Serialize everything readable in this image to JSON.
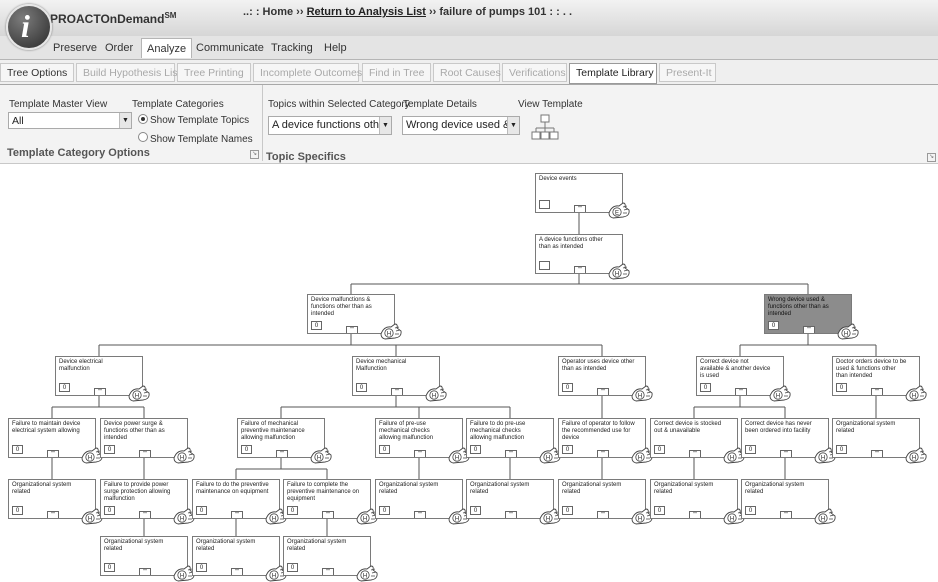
{
  "app": {
    "logo_letter": "i",
    "name": "PROACTOnDemand",
    "trademark": "SM"
  },
  "breadcrumb": {
    "prefix": "..: : Home ›› ",
    "link": "Return to Analysis List",
    "suffix": " ›› failure of pumps 101 : : . ."
  },
  "main_nav": [
    "Preserve",
    "Order",
    "Analyze",
    "Communicate",
    "Tracking",
    "Help"
  ],
  "main_nav_active": "Analyze",
  "sub_tabs": [
    {
      "label": "Tree Options",
      "state": "enabled"
    },
    {
      "label": "Build Hypothesis List",
      "state": "disabled"
    },
    {
      "label": "Tree Printing",
      "state": "disabled"
    },
    {
      "label": "Incomplete Outcomes",
      "state": "disabled"
    },
    {
      "label": "Find in Tree",
      "state": "disabled"
    },
    {
      "label": "Root Causes",
      "state": "disabled"
    },
    {
      "label": "Verifications",
      "state": "disabled"
    },
    {
      "label": "Template Library",
      "state": "active"
    },
    {
      "label": "Present-It",
      "state": "disabled"
    }
  ],
  "ribbon": {
    "master_view": {
      "label": "Template Master View",
      "value": "All"
    },
    "categories": {
      "label": "Template Categories",
      "options": [
        {
          "label": "Show Template Topics",
          "checked": true
        },
        {
          "label": "Show Template Names",
          "checked": false
        }
      ]
    },
    "left_group_title": "Template Category Options",
    "topics": {
      "label": "Topics within Selected Category",
      "value": "A device functions other th"
    },
    "details": {
      "label": "Template Details",
      "value": "Wrong device used & fun"
    },
    "view": {
      "label": "View Template"
    },
    "right_group_title": "Topic Specifics"
  },
  "tree": {
    "expand_glyph": "\"\"",
    "nodes": [
      {
        "id": "n1",
        "text": "Device events",
        "count": "",
        "badge": "E",
        "highlight": false
      },
      {
        "id": "n2",
        "text": "A device functions other than as intended",
        "count": "",
        "badge": "H",
        "highlight": false
      },
      {
        "id": "n3",
        "text": "Device malfunctions & functions other than as intended",
        "count": "0",
        "badge": "H",
        "highlight": false
      },
      {
        "id": "n4",
        "text": "Wrong device used & functions other than as intended",
        "count": "0",
        "badge": "H",
        "highlight": true
      },
      {
        "id": "n5",
        "text": "Device electrical malfunction",
        "count": "0",
        "badge": "H",
        "highlight": false
      },
      {
        "id": "n6",
        "text": "Device mechanical Malfunction",
        "count": "0",
        "badge": "H",
        "highlight": false
      },
      {
        "id": "n7",
        "text": "Operator uses device other than as intended",
        "count": "0",
        "badge": "H",
        "highlight": false
      },
      {
        "id": "n8",
        "text": "Correct device not available & another device is used",
        "count": "0",
        "badge": "H",
        "highlight": false
      },
      {
        "id": "n9",
        "text": "Doctor orders device to be used & functions other than intended",
        "count": "0",
        "badge": "H",
        "highlight": false
      },
      {
        "id": "n10",
        "text": "Failure to maintain device electrical system allowing",
        "count": "0",
        "badge": "H",
        "highlight": false
      },
      {
        "id": "n11",
        "text": "Device power surge & functions other than as intended",
        "count": "0",
        "badge": "H",
        "highlight": false
      },
      {
        "id": "n12",
        "text": "Failure of mechanical preventive maintenance allowing malfunction",
        "count": "0",
        "badge": "H",
        "highlight": false
      },
      {
        "id": "n13",
        "text": "Failure of pre-use mechanical checks allowing malfunction",
        "count": "0",
        "badge": "H",
        "highlight": false
      },
      {
        "id": "n14",
        "text": "Failure to do pre-use mechanical checks allowing malfunction",
        "count": "0",
        "badge": "H",
        "highlight": false
      },
      {
        "id": "n15",
        "text": "Failure of operator to follow the recommended use for device",
        "count": "0",
        "badge": "H",
        "highlight": false
      },
      {
        "id": "n16",
        "text": "Correct device is stocked out & unavailable",
        "count": "0",
        "badge": "H",
        "highlight": false
      },
      {
        "id": "n17",
        "text": "Correct device has never been ordered into facility",
        "count": "0",
        "badge": "H",
        "highlight": false
      },
      {
        "id": "n18",
        "text": "Organizational system related",
        "count": "0",
        "badge": "H",
        "highlight": false
      },
      {
        "id": "n19",
        "text": "Organizational system related",
        "count": "0",
        "badge": "H",
        "highlight": false
      },
      {
        "id": "n20",
        "text": "Failure to provide power surge protection allowing malfunction",
        "count": "0",
        "badge": "H",
        "highlight": false
      },
      {
        "id": "n21",
        "text": "Failure to do the preventive maintenance on equipment",
        "count": "0",
        "badge": "H",
        "highlight": false
      },
      {
        "id": "n22",
        "text": "Failure to complete the preventive maintenance on equipment",
        "count": "0",
        "badge": "H",
        "highlight": false
      },
      {
        "id": "n23",
        "text": "Organizational system related",
        "count": "0",
        "badge": "H",
        "highlight": false
      },
      {
        "id": "n24",
        "text": "Organizational system related",
        "count": "0",
        "badge": "H",
        "highlight": false
      },
      {
        "id": "n25",
        "text": "Organizational system related",
        "count": "0",
        "badge": "H",
        "highlight": false
      },
      {
        "id": "n26",
        "text": "Organizational system related",
        "count": "0",
        "badge": "H",
        "highlight": false
      },
      {
        "id": "n27",
        "text": "Organizational system related",
        "count": "0",
        "badge": "H",
        "highlight": false
      },
      {
        "id": "n28",
        "text": "Organizational system related",
        "count": "0",
        "badge": "H",
        "highlight": false
      },
      {
        "id": "n29",
        "text": "Organizational system related",
        "count": "0",
        "badge": "H",
        "highlight": false
      },
      {
        "id": "n30",
        "text": "Organizational system related",
        "count": "0",
        "badge": "H",
        "highlight": false
      },
      {
        "id": "n31",
        "text": "Organizational system related",
        "count": "0",
        "badge": "H",
        "highlight": false
      }
    ],
    "edges": [
      [
        "n1",
        "n2"
      ],
      [
        "n2",
        "n3"
      ],
      [
        "n2",
        "n4"
      ],
      [
        "n3",
        "n5"
      ],
      [
        "n3",
        "n6"
      ],
      [
        "n3",
        "n7"
      ],
      [
        "n4",
        "n8"
      ],
      [
        "n4",
        "n9"
      ],
      [
        "n5",
        "n10"
      ],
      [
        "n5",
        "n11"
      ],
      [
        "n6",
        "n12"
      ],
      [
        "n6",
        "n13"
      ],
      [
        "n6",
        "n14"
      ],
      [
        "n7",
        "n15"
      ],
      [
        "n8",
        "n16"
      ],
      [
        "n8",
        "n17"
      ],
      [
        "n9",
        "n18"
      ],
      [
        "n10",
        "n19"
      ],
      [
        "n11",
        "n20"
      ],
      [
        "n12",
        "n21"
      ],
      [
        "n12",
        "n22"
      ],
      [
        "n13",
        "n23"
      ],
      [
        "n14",
        "n24"
      ],
      [
        "n15",
        "n25"
      ],
      [
        "n16",
        "n26"
      ],
      [
        "n17",
        "n27"
      ],
      [
        "n20",
        "n28"
      ],
      [
        "n21",
        "n29"
      ],
      [
        "n22",
        "n30"
      ]
    ]
  }
}
